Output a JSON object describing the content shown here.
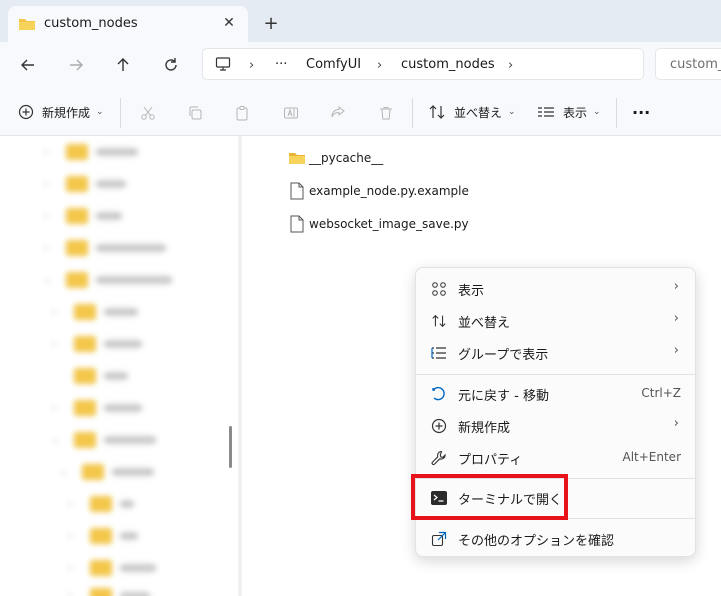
{
  "tab": {
    "title": "custom_nodes",
    "close": "✕",
    "new_tab": "+"
  },
  "address": {
    "more": "···",
    "segments": [
      "ComfyUI",
      "custom_nodes"
    ]
  },
  "search": {
    "placeholder": "custom_"
  },
  "toolbar": {
    "new_label": "新規作成",
    "sort_label": "並べ替え",
    "view_label": "表示",
    "more": "···"
  },
  "files": [
    {
      "name": "__pycache__",
      "type": "folder"
    },
    {
      "name": "example_node.py.example",
      "type": "file"
    },
    {
      "name": "websocket_image_save.py",
      "type": "file"
    }
  ],
  "context_menu": {
    "items": [
      {
        "label": "表示",
        "icon": "grid-icon",
        "submenu": true
      },
      {
        "label": "並べ替え",
        "icon": "sort-icon",
        "submenu": true
      },
      {
        "label": "グループで表示",
        "icon": "group-list-icon",
        "submenu": true
      },
      {
        "label": "元に戻す - 移動",
        "icon": "undo-icon",
        "shortcut": "Ctrl+Z"
      },
      {
        "label": "新規作成",
        "icon": "new-icon",
        "submenu": true
      },
      {
        "label": "プロパティ",
        "icon": "wrench-icon",
        "shortcut": "Alt+Enter"
      },
      {
        "label": "ターミナルで開く",
        "icon": "terminal-icon"
      },
      {
        "label": "その他のオプションを確認",
        "icon": "share-icon"
      }
    ]
  },
  "colors": {
    "highlight": "#e8121b",
    "folder": "#f3c64a",
    "accent": "#0067c0"
  }
}
